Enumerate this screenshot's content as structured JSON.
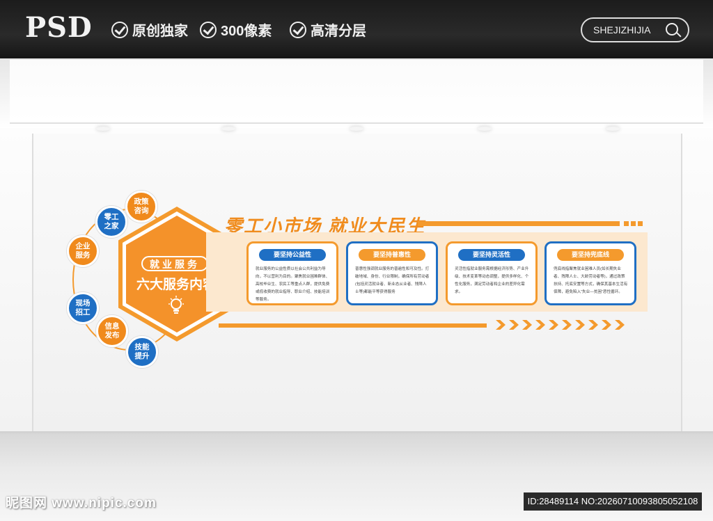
{
  "header": {
    "logo": "PSD",
    "features": [
      "原创独家",
      "300像素",
      "高清分层"
    ],
    "search_text": "SHEJIZHIJIA"
  },
  "board": {
    "title": "零工小市场 就业大民生",
    "pill": "就业服务",
    "hex_title": "六大服务内容",
    "bubbles": [
      {
        "label": "政策\n咨询",
        "color": "orange"
      },
      {
        "label": "零工\n之家",
        "color": "blue"
      },
      {
        "label": "企业\n服务",
        "color": "orange"
      },
      {
        "label": "现场\n招工",
        "color": "blue"
      },
      {
        "label": "信息\n发布",
        "color": "orange"
      },
      {
        "label": "技能\n提升",
        "color": "blue"
      }
    ],
    "cards": [
      {
        "heading": "要坚持公益性",
        "body": "就业服务的公益性质以社会公共利益为导向，不以营利为目的。聚焦就业困难群体、高校毕业生、农民工等重点人群，提供免费或低收费的就业指导、职业介绍、技能培训等服务。"
      },
      {
        "heading": "要坚持普惠性",
        "body": "普惠性强调就业服务的普遍性和可及性。打破地域、身份、行业限制，确保所有劳动者(包括灵活就业者、新业态从业者、残障人士等)都能平等获得服务"
      },
      {
        "heading": "要坚持灵活性",
        "body": "灵活性指就业服务需根据经济形势、产业升级、技术变革等动态调整，提供多样化、个性化服务，满足劳动者和企业的差异化需求。"
      },
      {
        "heading": "要坚持兜底线",
        "body": "兜底线指聚焦就业困难人员(如长期失业者、残障人士、大龄劳动者等)，通过政策扶持、托底安置等方式，确保其基本生活有保障，避免陷入“失业—贫困”恶性循环。"
      }
    ]
  },
  "watermark": {
    "left": "昵图网 www.nipic.com",
    "right": "ID:28489114 NO:20260710093805052108"
  }
}
